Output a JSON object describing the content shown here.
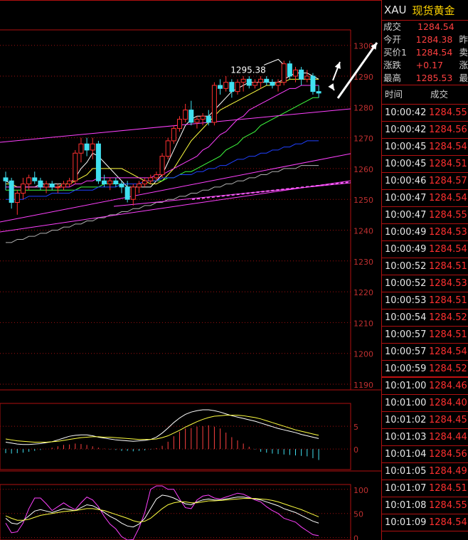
{
  "quote": {
    "symbol": "XAU",
    "name": "现货黄金",
    "rows": [
      {
        "label": "成交",
        "value": "1284.54",
        "extra": ""
      },
      {
        "label": "今开",
        "value": "1284.38",
        "extra": "昨"
      },
      {
        "label": "买价1",
        "value": "1284.54",
        "extra": "卖"
      },
      {
        "label": "涨跌",
        "value": "+0.17",
        "extra": "涨"
      },
      {
        "label": "最高",
        "value": "1285.53",
        "extra": "最"
      }
    ]
  },
  "ticks": {
    "header_time": "时间",
    "header_price": "成交",
    "rows": [
      {
        "time": "10:00:42",
        "price": "1284.55"
      },
      {
        "time": "10:00:42",
        "price": "1284.56"
      },
      {
        "time": "10:00:45",
        "price": "1284.54"
      },
      {
        "time": "10:00:45",
        "price": "1284.51"
      },
      {
        "time": "10:00:46",
        "price": "1284.57"
      },
      {
        "time": "10:00:47",
        "price": "1284.54"
      },
      {
        "time": "10:00:47",
        "price": "1284.55"
      },
      {
        "time": "10:00:49",
        "price": "1284.53"
      },
      {
        "time": "10:00:49",
        "price": "1284.54"
      },
      {
        "time": "10:00:52",
        "price": "1284.51"
      },
      {
        "time": "10:00:52",
        "price": "1284.53"
      },
      {
        "time": "10:00:53",
        "price": "1284.51"
      },
      {
        "time": "10:00:54",
        "price": "1284.52"
      },
      {
        "time": "10:00:57",
        "price": "1284.51"
      },
      {
        "time": "10:00:57",
        "price": "1284.54"
      },
      {
        "time": "10:00:59",
        "price": "1284.52"
      },
      {
        "time": "10:01:00",
        "price": "1284.46"
      },
      {
        "time": "10:01:00",
        "price": "1284.40"
      },
      {
        "time": "10:01:02",
        "price": "1284.45"
      },
      {
        "time": "10:01:03",
        "price": "1284.44"
      },
      {
        "time": "10:01:04",
        "price": "1284.56"
      },
      {
        "time": "10:01:05",
        "price": "1284.49"
      },
      {
        "time": "10:01:07",
        "price": "1284.51"
      },
      {
        "time": "10:01:08",
        "price": "1284.55"
      },
      {
        "time": "10:01:09",
        "price": "1284.54"
      }
    ]
  },
  "chart_data": [
    {
      "type": "candlestick",
      "y_ticks": [
        1190,
        1200,
        1210,
        1220,
        1230,
        1240,
        1250,
        1260,
        1270,
        1280,
        1290,
        1300
      ],
      "ylim": [
        1190,
        1305
      ],
      "annotation": "1295.38",
      "grid": true,
      "colors": {
        "up": "#ff3030",
        "down": "#40e0f0"
      },
      "candles": [
        [
          1257,
          1259,
          1253,
          1256
        ],
        [
          1256,
          1257,
          1247,
          1249
        ],
        [
          1249,
          1253,
          1245,
          1252
        ],
        [
          1252,
          1257,
          1250,
          1255
        ],
        [
          1255,
          1258,
          1253,
          1257
        ],
        [
          1257,
          1259,
          1255,
          1256
        ],
        [
          1256,
          1257,
          1253,
          1254
        ],
        [
          1254,
          1256,
          1252,
          1255
        ],
        [
          1255,
          1256,
          1253,
          1254
        ],
        [
          1254,
          1255,
          1252,
          1254
        ],
        [
          1254,
          1256,
          1253,
          1255
        ],
        [
          1255,
          1257,
          1254,
          1256
        ],
        [
          1256,
          1266,
          1255,
          1265
        ],
        [
          1265,
          1270,
          1262,
          1268
        ],
        [
          1268,
          1270,
          1264,
          1266
        ],
        [
          1266,
          1270,
          1263,
          1268
        ],
        [
          1268,
          1269,
          1255,
          1256
        ],
        [
          1256,
          1258,
          1254,
          1255
        ],
        [
          1255,
          1257,
          1253,
          1256
        ],
        [
          1256,
          1257,
          1254,
          1255
        ],
        [
          1255,
          1256,
          1252,
          1254
        ],
        [
          1254,
          1256,
          1249,
          1250
        ],
        [
          1250,
          1255,
          1248,
          1254
        ],
        [
          1254,
          1256,
          1252,
          1255
        ],
        [
          1255,
          1257,
          1254,
          1256
        ],
        [
          1256,
          1258,
          1255,
          1257
        ],
        [
          1257,
          1259,
          1256,
          1258
        ],
        [
          1258,
          1265,
          1257,
          1264
        ],
        [
          1264,
          1270,
          1263,
          1269
        ],
        [
          1269,
          1274,
          1268,
          1273
        ],
        [
          1273,
          1277,
          1272,
          1276
        ],
        [
          1276,
          1281,
          1275,
          1279
        ],
        [
          1279,
          1282,
          1274,
          1275
        ],
        [
          1275,
          1277,
          1273,
          1276
        ],
        [
          1276,
          1278,
          1274,
          1277
        ],
        [
          1277,
          1279,
          1274,
          1275
        ],
        [
          1275,
          1288,
          1274,
          1287
        ],
        [
          1287,
          1289,
          1284,
          1286
        ],
        [
          1286,
          1290,
          1285,
          1288
        ],
        [
          1288,
          1289,
          1283,
          1285
        ],
        [
          1285,
          1289,
          1284,
          1288
        ],
        [
          1288,
          1290,
          1285,
          1289
        ],
        [
          1289,
          1290,
          1286,
          1287
        ],
        [
          1287,
          1289,
          1286,
          1288
        ],
        [
          1288,
          1290,
          1286,
          1289
        ],
        [
          1289,
          1290,
          1287,
          1288
        ],
        [
          1288,
          1289,
          1286,
          1287
        ],
        [
          1287,
          1289,
          1285,
          1288
        ],
        [
          1288,
          1295,
          1287,
          1294
        ],
        [
          1294,
          1295,
          1289,
          1290
        ],
        [
          1290,
          1293,
          1288,
          1292
        ],
        [
          1292,
          1293,
          1287,
          1289
        ],
        [
          1289,
          1292,
          1288,
          1290
        ],
        [
          1290,
          1291,
          1284,
          1285
        ],
        [
          1285,
          1287,
          1283,
          1284.5
        ]
      ],
      "ma": [
        {
          "name": "MA5",
          "color": "#ffffff",
          "values": [
            1256,
            1255,
            1254,
            1254,
            1254,
            1254,
            1255,
            1255,
            1255,
            1255,
            1255,
            1255,
            1257,
            1260,
            1262,
            1265,
            1264,
            1262,
            1260,
            1258,
            1256,
            1254,
            1254,
            1254,
            1254,
            1254,
            1256,
            1258,
            1262,
            1266,
            1270,
            1274,
            1276,
            1277,
            1277,
            1277,
            1279,
            1281,
            1283,
            1285,
            1286,
            1287,
            1288,
            1288,
            1288,
            1288,
            1288,
            1288,
            1289,
            1290,
            1291,
            1291,
            1291,
            1290,
            1289
          ]
        },
        {
          "name": "MA10",
          "color": "#ffff40",
          "values": [
            1255,
            1255,
            1254,
            1254,
            1254,
            1254,
            1254,
            1254,
            1254,
            1254,
            1255,
            1255,
            1256,
            1257,
            1258,
            1260,
            1260,
            1260,
            1260,
            1260,
            1260,
            1259,
            1258,
            1257,
            1256,
            1255,
            1255,
            1256,
            1258,
            1260,
            1263,
            1266,
            1269,
            1271,
            1273,
            1275,
            1277,
            1279,
            1280,
            1281,
            1282,
            1283,
            1284,
            1285,
            1286,
            1287,
            1287,
            1288,
            1288,
            1289,
            1289,
            1289,
            1289,
            1289,
            1289
          ]
        },
        {
          "name": "MA20",
          "color": "#ff40ff",
          "values": [
            1254,
            1254,
            1254,
            1254,
            1254,
            1254,
            1254,
            1254,
            1254,
            1254,
            1254,
            1254,
            1255,
            1255,
            1256,
            1256,
            1257,
            1257,
            1257,
            1257,
            1257,
            1257,
            1257,
            1257,
            1257,
            1257,
            1258,
            1258,
            1259,
            1260,
            1261,
            1262,
            1263,
            1264,
            1266,
            1267,
            1269,
            1271,
            1272,
            1274,
            1276,
            1277,
            1279,
            1280,
            1281,
            1282,
            1283,
            1284,
            1285,
            1286,
            1286,
            1287,
            1287,
            1287,
            1287
          ]
        },
        {
          "name": "MA30",
          "color": "#40ff40",
          "values": [
            1253,
            1253,
            1253,
            1253,
            1253,
            1253,
            1253,
            1253,
            1253,
            1253,
            1253,
            1253,
            1253,
            1254,
            1254,
            1254,
            1254,
            1255,
            1255,
            1255,
            1255,
            1255,
            1255,
            1255,
            1256,
            1256,
            1256,
            1256,
            1257,
            1257,
            1258,
            1259,
            1259,
            1260,
            1261,
            1262,
            1263,
            1264,
            1266,
            1267,
            1268,
            1270,
            1271,
            1272,
            1274,
            1275,
            1276,
            1277,
            1278,
            1279,
            1280,
            1281,
            1282,
            1283,
            1283
          ]
        },
        {
          "name": "MA60",
          "color": "#2040ff",
          "values": [
            1250,
            1250,
            1250,
            1250,
            1251,
            1251,
            1251,
            1251,
            1252,
            1252,
            1252,
            1252,
            1253,
            1253,
            1253,
            1253,
            1254,
            1254,
            1254,
            1254,
            1255,
            1255,
            1255,
            1255,
            1256,
            1256,
            1256,
            1257,
            1257,
            1257,
            1258,
            1258,
            1258,
            1259,
            1259,
            1260,
            1260,
            1261,
            1261,
            1262,
            1263,
            1263,
            1264,
            1264,
            1265,
            1265,
            1266,
            1266,
            1267,
            1267,
            1268,
            1268,
            1269,
            1269,
            1269
          ]
        },
        {
          "name": "MA120",
          "color": "#b0b0b0",
          "values": [
            1236,
            1236,
            1237,
            1237,
            1238,
            1238,
            1239,
            1239,
            1240,
            1240,
            1241,
            1241,
            1242,
            1242,
            1243,
            1243,
            1244,
            1244,
            1245,
            1245,
            1246,
            1246,
            1247,
            1247,
            1248,
            1248,
            1249,
            1249,
            1250,
            1250,
            1251,
            1251,
            1252,
            1252,
            1253,
            1253,
            1254,
            1254,
            1255,
            1255,
            1256,
            1256,
            1257,
            1257,
            1258,
            1258,
            1259,
            1259,
            1260,
            1260,
            1260,
            1261,
            1261,
            1261,
            1261
          ]
        }
      ]
    },
    {
      "type": "bar",
      "indicator": "MACD",
      "y_ticks": [
        0,
        5
      ],
      "ylim": [
        -4.5,
        10
      ],
      "histogram": [
        -0.9,
        -1.0,
        -0.9,
        -0.8,
        -0.6,
        -0.4,
        -0.2,
        0.0,
        0.3,
        0.6,
        0.9,
        1.0,
        1.2,
        1.1,
        0.9,
        0.6,
        0.3,
        0.1,
        -0.1,
        -0.2,
        -0.4,
        -0.4,
        -0.5,
        -0.4,
        -0.3,
        -0.1,
        0.2,
        0.7,
        1.6,
        2.8,
        3.8,
        4.5,
        4.6,
        4.9,
        5.0,
        5.2,
        4.9,
        4.5,
        3.6,
        2.6,
        1.9,
        1.2,
        0.5,
        -0.1,
        -0.6,
        -0.8,
        -1.0,
        -1.1,
        -1.2,
        -1.3,
        -1.4,
        -1.5,
        -1.6,
        -2.0,
        -2.4
      ],
      "dif": [
        1.5,
        1.3,
        1.1,
        1.0,
        1.0,
        1.1,
        1.2,
        1.4,
        1.6,
        2.0,
        2.4,
        2.8,
        3.0,
        3.1,
        3.1,
        2.9,
        2.6,
        2.4,
        2.2,
        2.0,
        1.9,
        1.8,
        1.7,
        1.8,
        1.9,
        2.1,
        2.6,
        3.5,
        4.6,
        5.8,
        6.8,
        7.6,
        8.1,
        8.4,
        8.6,
        8.6,
        8.4,
        8.1,
        7.7,
        7.3,
        7.0,
        6.7,
        6.4,
        6.1,
        5.7,
        5.3,
        4.9,
        4.5,
        4.2,
        3.9,
        3.6,
        3.2,
        2.9,
        2.6,
        2.3
      ],
      "dea": [
        2.2,
        2.0,
        1.8,
        1.7,
        1.6,
        1.5,
        1.5,
        1.5,
        1.6,
        1.7,
        1.9,
        2.1,
        2.3,
        2.5,
        2.6,
        2.7,
        2.7,
        2.6,
        2.6,
        2.5,
        2.4,
        2.3,
        2.2,
        2.1,
        2.1,
        2.1,
        2.2,
        2.5,
        2.9,
        3.5,
        4.1,
        4.8,
        5.4,
        6.0,
        6.5,
        6.9,
        7.2,
        7.3,
        7.4,
        7.4,
        7.4,
        7.3,
        7.1,
        6.9,
        6.6,
        6.2,
        5.8,
        5.4,
        5.0,
        4.6,
        4.2,
        3.9,
        3.6,
        3.3,
        3.0
      ]
    },
    {
      "type": "line",
      "indicator": "KDJ",
      "y_ticks": [
        0,
        50,
        100
      ],
      "ylim": [
        -5,
        110
      ],
      "k": [
        40,
        30,
        28,
        35,
        45,
        55,
        58,
        55,
        52,
        56,
        60,
        58,
        56,
        62,
        68,
        66,
        60,
        52,
        44,
        38,
        30,
        24,
        22,
        28,
        40,
        60,
        80,
        88,
        86,
        82,
        76,
        70,
        68,
        74,
        78,
        80,
        78,
        78,
        80,
        82,
        84,
        84,
        82,
        80,
        78,
        74,
        70,
        66,
        60,
        56,
        52,
        46,
        40,
        34,
        30
      ],
      "d": [
        45,
        40,
        36,
        36,
        38,
        42,
        46,
        48,
        50,
        52,
        54,
        55,
        56,
        58,
        60,
        60,
        58,
        56,
        52,
        48,
        44,
        40,
        35,
        32,
        34,
        40,
        50,
        60,
        68,
        72,
        74,
        74,
        72,
        72,
        74,
        76,
        76,
        77,
        78,
        79,
        80,
        81,
        81,
        81,
        80,
        79,
        77,
        74,
        70,
        66,
        62,
        58,
        53,
        48,
        43
      ],
      "j": [
        30,
        10,
        12,
        30,
        60,
        82,
        82,
        70,
        56,
        64,
        72,
        64,
        58,
        72,
        84,
        78,
        64,
        44,
        28,
        18,
        2,
        -6,
        -4,
        20,
        52,
        100,
        110,
        110,
        100,
        100,
        80,
        62,
        60,
        78,
        86,
        88,
        82,
        80,
        84,
        88,
        92,
        90,
        84,
        78,
        74,
        64,
        56,
        50,
        40,
        36,
        32,
        22,
        14,
        6,
        4
      ]
    }
  ]
}
